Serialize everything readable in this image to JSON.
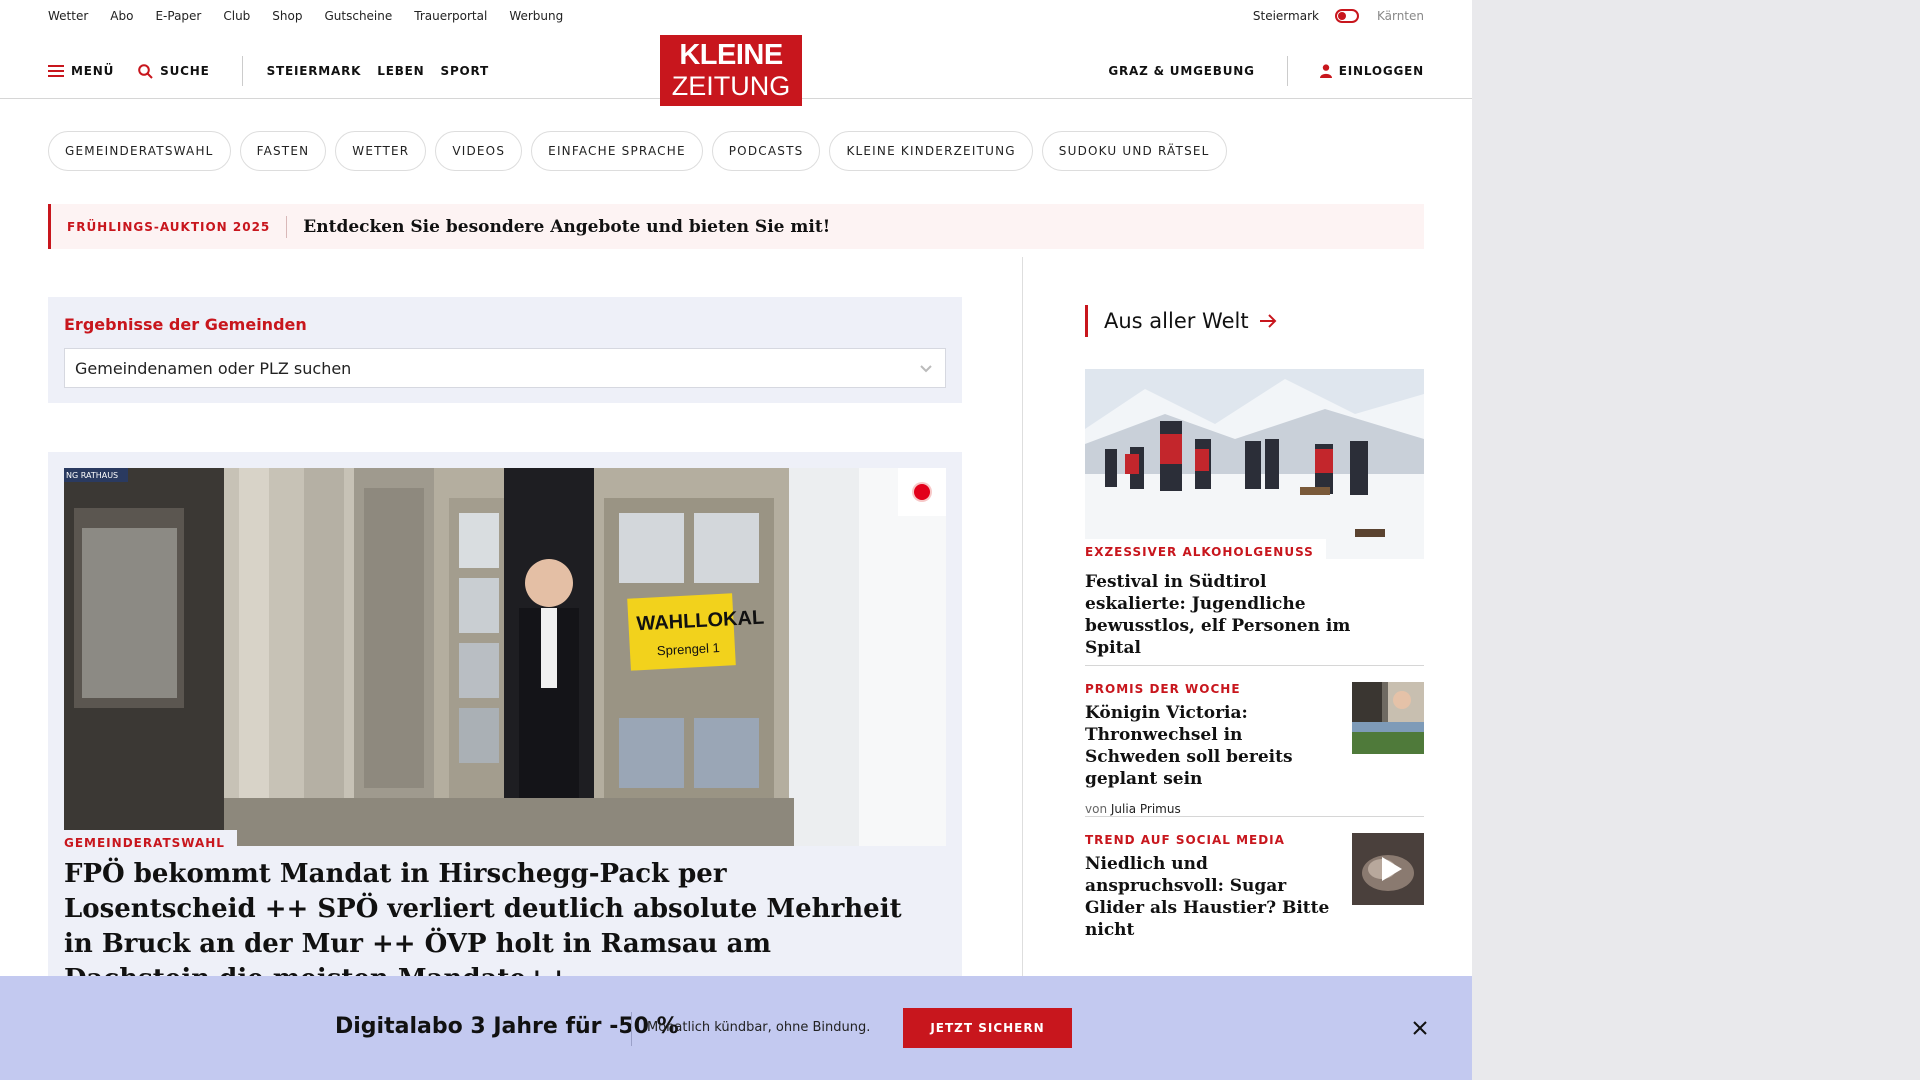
{
  "topbar": {
    "links": [
      "Wetter",
      "Abo",
      "E-Paper",
      "Club",
      "Shop",
      "Gutscheine",
      "Trauerportal",
      "Werbung"
    ],
    "region_active": "Steiermark",
    "region_other": "Kärnten"
  },
  "nav": {
    "menu_label": "MENÜ",
    "search_label": "SUCHE",
    "links": [
      "STEIERMARK",
      "LEBEN",
      "SPORT"
    ],
    "logo_line1": "KLEINE",
    "logo_line2": "ZEITUNG",
    "region_link": "GRAZ & UMGEBUNG",
    "login_label": "EINLOGGEN"
  },
  "chips": [
    "GEMEINDERATSWAHL",
    "FASTEN",
    "WETTER",
    "VIDEOS",
    "EINFACHE SPRACHE",
    "PODCASTS",
    "KLEINE KINDERZEITUNG",
    "SUDOKU UND RÄTSEL"
  ],
  "promo": {
    "tag": "FRÜHLINGS-AUKTION 2025",
    "text": "Entdecken Sie besondere Angebote und bieten Sie mit!"
  },
  "gemeinden": {
    "title": "Ergebnisse der Gemeinden",
    "placeholder": "Gemeindenamen oder PLZ suchen"
  },
  "hero": {
    "kicker": "GEMEINDERATSWAHL",
    "headline": "FPÖ bekommt Mandat in Hirschegg-Pack per Losentscheid ++ SPÖ verliert deutlich absolute Mehrheit in Bruck an der Mur ++ ÖVP holt in Ramsau am Dachstein die meisten Mandate++",
    "sign_text_1": "WAHLLOKAL",
    "sign_text_2": "Sprengel 1",
    "corner_sign": "NG RATHAUS"
  },
  "right": {
    "section_title": "Aus aller Welt",
    "feature": {
      "kicker": "EXZESSIVER ALKOHOLGENUSS",
      "headline": "Festival in Südtirol eskalierte: Jugendliche bewusstlos, elf Personen im Spital"
    },
    "items": [
      {
        "kicker": "PROMIS DER WOCHE",
        "headline": "Königin Victoria: Thronwechsel in Schweden soll bereits geplant sein",
        "byline_prefix": "von",
        "author": "Julia Primus"
      },
      {
        "kicker": "TREND AUF SOCIAL MEDIA",
        "headline": "Niedlich und anspruchsvoll: Sugar Glider als Haustier? Bitte nicht"
      }
    ]
  },
  "banner": {
    "headline": "Digitalabo 3 Jahre für -50 %",
    "subtext": "Monatlich kündbar, ohne Bindung.",
    "cta": "JETZT SICHERN"
  },
  "colors": {
    "brand_red": "#c8161d",
    "banner_bg": "#c3c9f0",
    "box_bg": "#eef0f8"
  }
}
